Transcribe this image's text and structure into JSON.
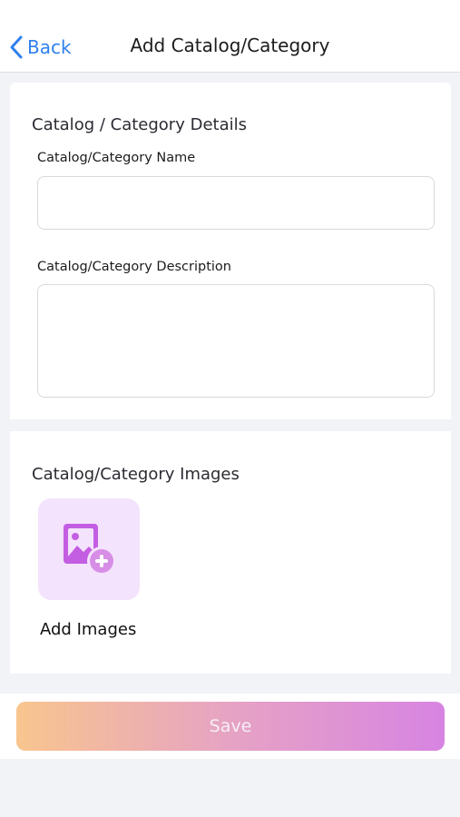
{
  "header": {
    "back_label": "Back",
    "title": "Add Catalog/Category",
    "back_icon": "chevron-left-icon",
    "accent": "#2f80ed"
  },
  "details": {
    "section_title": "Catalog / Category Details",
    "name_label": "Catalog/Category Name",
    "name_value": "",
    "description_label": "Catalog/Category Description",
    "description_value": ""
  },
  "images": {
    "section_title": "Catalog/Category Images",
    "add_label": "Add Images",
    "add_icon": "add-image-icon",
    "tile_color": "#f4e3fc",
    "icon_color": "#c35ee3"
  },
  "footer": {
    "save_label": "Save",
    "gradient": [
      "#f8c58e",
      "#e6a3c4",
      "#d784e2"
    ]
  }
}
